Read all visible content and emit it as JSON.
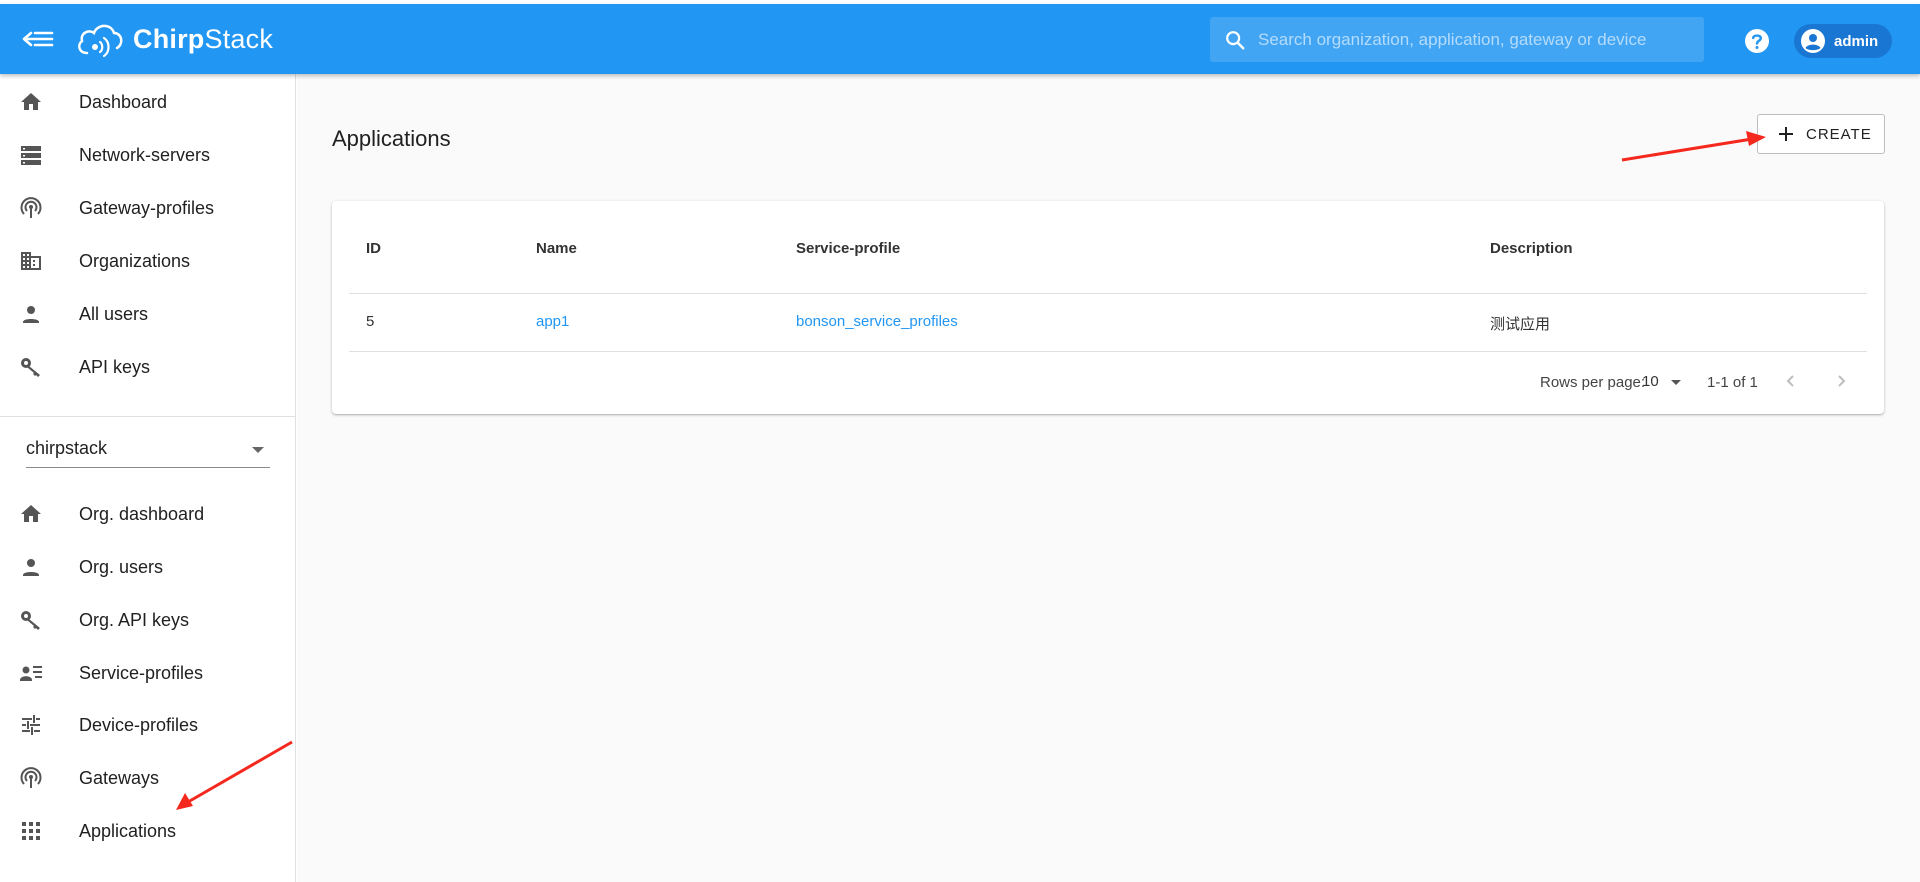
{
  "app": {
    "brand_bold": "Chirp",
    "brand_light": "Stack"
  },
  "header": {
    "search_placeholder": "Search organization, application, gateway or device",
    "user_name": "admin"
  },
  "sidebar": {
    "global_items": [
      {
        "label": "Dashboard",
        "icon": "home-icon"
      },
      {
        "label": "Network-servers",
        "icon": "server-icon"
      },
      {
        "label": "Gateway-profiles",
        "icon": "antenna-icon"
      },
      {
        "label": "Organizations",
        "icon": "building-icon"
      },
      {
        "label": "All users",
        "icon": "person-icon"
      },
      {
        "label": "API keys",
        "icon": "key-icon"
      }
    ],
    "org_select_value": "chirpstack",
    "org_items": [
      {
        "label": "Org. dashboard",
        "icon": "home-icon"
      },
      {
        "label": "Org. users",
        "icon": "person-icon"
      },
      {
        "label": "Org. API keys",
        "icon": "key-icon"
      },
      {
        "label": "Service-profiles",
        "icon": "account-details-icon"
      },
      {
        "label": "Device-profiles",
        "icon": "tune-icon"
      },
      {
        "label": "Gateways",
        "icon": "antenna-icon"
      },
      {
        "label": "Applications",
        "icon": "apps-grid-icon"
      }
    ]
  },
  "main": {
    "title": "Applications",
    "create_label": "CREATE",
    "table": {
      "columns": [
        "ID",
        "Name",
        "Service-profile",
        "Description"
      ],
      "rows": [
        {
          "id": "5",
          "name": "app1",
          "service_profile": "bonson_service_profiles",
          "description": "测试应用"
        }
      ]
    },
    "pagination": {
      "rows_per_page_label": "Rows per page:",
      "rows_per_page": "10",
      "range": "1-1 of 1"
    }
  },
  "colors": {
    "primary": "#2196f3",
    "annotation_arrow": "#f5281e"
  }
}
